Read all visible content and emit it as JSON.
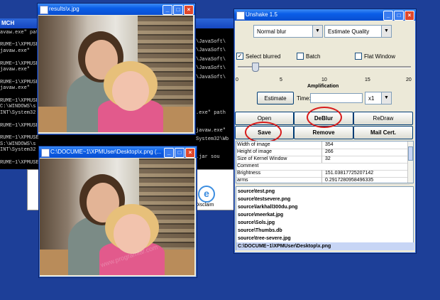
{
  "console": {
    "title": "MCH",
    "left_lines": [
      "avaw.exe\" path",
      "",
      "RUME~1\\XPMUSE",
      "javaw.exe\"",
      "",
      "RUME~1\\XPMUSE",
      "javaw.exe\"",
      "",
      "RUME~1\\XPMUSE",
      "javaw.exe\"",
      "",
      "RUME~1\\XPMUSE",
      "C:\\WINDOWS\\s",
      "INT\\System32",
      "",
      "RUME~1\\XPMUSE",
      "",
      "RUME~1\\XPMUSE",
      "S:\\WINDOWS\\s",
      "INT\\System32",
      "",
      "RUME~1\\XPMUSER\\DESKTOP\\UNSHAKE>path"
    ],
    "right_lines": [
      "",
      "\\JavaSoft\\",
      "\\JavaSoft\\",
      "\\JavaSoft\\",
      "\\JavaSoft\\",
      "\\JavaSoft\\",
      "",
      "",
      "",
      ".exe\" path",
      "",
      "javaw.exe\"",
      "System32\\Wb",
      "",
      ".jar sou"
    ]
  },
  "explorer": {
    "file_label": "Disclaim"
  },
  "results_window": {
    "title": "results\\x.jpg"
  },
  "input_window": {
    "title": "C:\\DOCUME~1\\XPMUser\\Desktop\\x.png (..."
  },
  "unshake": {
    "title": "Unshake 1.5",
    "blur_mode": "Normal blur",
    "quality_mode": "Estimate Quality",
    "select_blurred_label": "Select blurred",
    "select_blurred_checked": true,
    "batch_label": "Batch",
    "batch_checked": false,
    "flat_window_label": "Flat Window",
    "flat_window_checked": false,
    "slider_ticks": [
      "0",
      "5",
      "10",
      "15",
      "20"
    ],
    "amplification_label": "Amplification",
    "amplification_value": 2,
    "estimate_label": "Estimate",
    "time_label": "Time:",
    "zoom_value": "x1",
    "buttons": {
      "open": "Open",
      "deblur": "DeBlur",
      "redraw": "ReDraw",
      "save": "Save",
      "remove": "Remove",
      "mail": "Mail Cert."
    },
    "properties": [
      {
        "k": "Width of image",
        "v": "354"
      },
      {
        "k": "Height of image",
        "v": "266"
      },
      {
        "k": "Size of Kernel Window",
        "v": "32"
      },
      {
        "k": "Comment",
        "v": ""
      },
      {
        "k": "Brightness",
        "v": "151.03817725207142"
      },
      {
        "k": "arms",
        "v": "0.2917280958496335"
      }
    ],
    "files": [
      "source\\test.png",
      "source\\testsevere.png",
      "source\\larkhall300du.png",
      "source\\meerkat.jpg",
      "source\\Sols.jpg",
      "source\\Thumbs.db",
      "source\\tree-severe.jpg",
      "C:\\DOCUME~1\\XPMUser\\Desktop\\x.png"
    ]
  },
  "watermark": "www.programlar.com",
  "colors": {
    "highlight_ring": "#d81c1c",
    "desktop": "#1d3f98",
    "selection": "#c7d5f5"
  }
}
